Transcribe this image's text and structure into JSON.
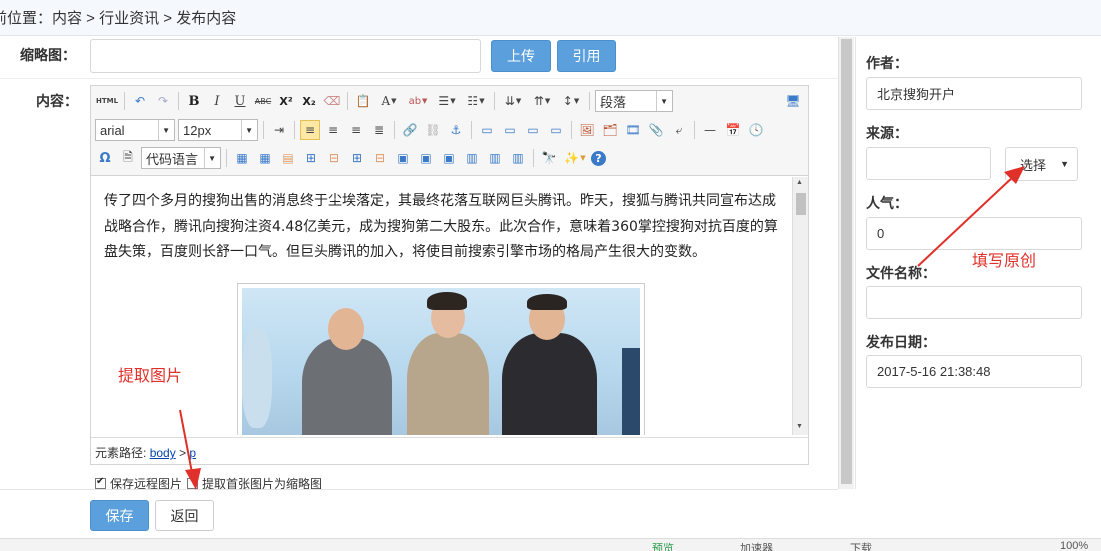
{
  "breadcrumb": {
    "text": "前位置：内容 > 行业资讯 > 发布内容"
  },
  "thumbnail": {
    "label": "缩略图：",
    "value": "",
    "upload_label": "上传",
    "reference_label": "引用"
  },
  "content": {
    "label": "内容："
  },
  "toolbar": {
    "html_label": "HTML",
    "paragraph_select": "段落",
    "font_select": "arial",
    "size_select": "12px",
    "code_lang_select": "代码语言"
  },
  "article": {
    "paragraph": "传了四个多月的搜狗出售的消息终于尘埃落定，其最终花落互联网巨头腾讯。昨天，搜狐与腾讯共同宣布达成战略合作，腾讯向搜狗注资4.48亿美元，成为搜狗第二大股东。此次合作，意味着360掌控搜狗对抗百度的算盘失策，百度则长舒一口气。但巨头腾讯的加入，将使目前搜索引擎市场的格局产生很大的变数。"
  },
  "elementpath": {
    "prefix": "元素路径:",
    "body": "body",
    "sep": ">",
    "p": "p"
  },
  "options": {
    "save_remote": "保存远程图片",
    "extract_first": "提取首张图片为缩略图"
  },
  "actions": {
    "save_label": "保存",
    "back_label": "返回"
  },
  "side": {
    "author_label": "作者：",
    "author_value": "北京搜狗开户",
    "source_label": "来源：",
    "source_value": "",
    "source_select": "选择",
    "popularity_label": "人气：",
    "popularity_value": "0",
    "filename_label": "文件名称：",
    "filename_value": "",
    "date_label": "发布日期：",
    "date_value": "2017-5-16 21:38:48"
  },
  "annotations": {
    "extract_image": "提取图片",
    "fill_original": "填写原创"
  },
  "statusbar": {
    "items": [
      "预览",
      "加速器",
      "下载",
      "100%"
    ]
  },
  "colors": {
    "primary_button": "#5b9fdc",
    "annotation": "#e0302a",
    "link": "#0645ad"
  }
}
